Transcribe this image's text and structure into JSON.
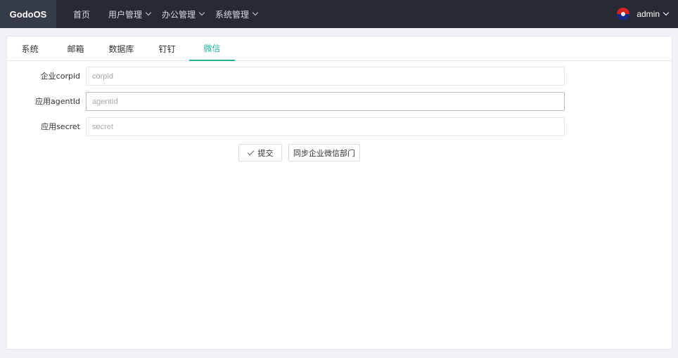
{
  "header": {
    "brand": "GodoOS",
    "nav": [
      {
        "label": "首页",
        "has_dropdown": false
      },
      {
        "label": "用户管理",
        "has_dropdown": true
      },
      {
        "label": "办公管理",
        "has_dropdown": true
      },
      {
        "label": "系统管理",
        "has_dropdown": true
      }
    ],
    "user": {
      "name": "admin"
    }
  },
  "tabs": [
    {
      "label": "系统",
      "active": false
    },
    {
      "label": "邮箱",
      "active": false
    },
    {
      "label": "数据库",
      "active": false
    },
    {
      "label": "钉钉",
      "active": false
    },
    {
      "label": "微信",
      "active": true
    }
  ],
  "form": {
    "fields": [
      {
        "label": "企业corpid",
        "placeholder": "corpid",
        "value": ""
      },
      {
        "label": "应用agentId",
        "placeholder": "agentId",
        "value": ""
      },
      {
        "label": "应用secret",
        "placeholder": "secret",
        "value": ""
      }
    ],
    "submit_label": "提交",
    "sync_label": "同步企业微信部门"
  },
  "colors": {
    "accent": "#1fb19e",
    "topbar": "#262b33",
    "brand_bg": "#373d48"
  },
  "icons": {
    "submit": "check-icon",
    "dropdown": "chevron-down-icon",
    "avatar": "avatar-icon"
  }
}
